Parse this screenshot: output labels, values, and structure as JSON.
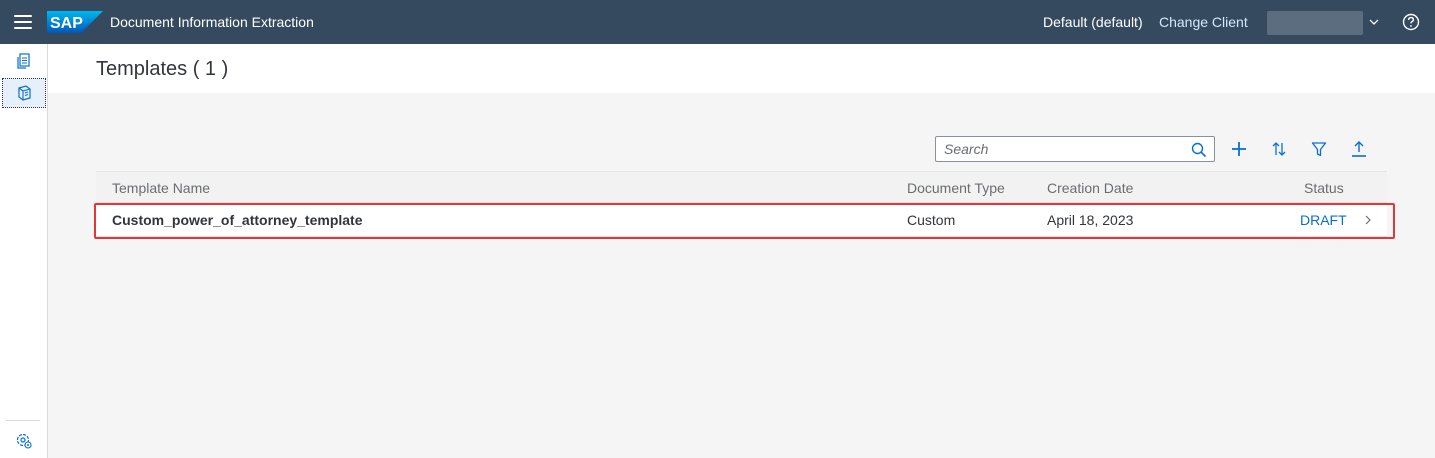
{
  "shell": {
    "title": "Document Information Extraction",
    "logo_text": "SAP",
    "tenant": "Default (default)",
    "change_client": "Change Client"
  },
  "icons": {
    "menu": "hamburger-menu-icon",
    "documents": "documents-icon",
    "templates": "templates-icon",
    "settings": "settings-icon",
    "help": "help-icon"
  },
  "page": {
    "title": "Templates ( 1 )"
  },
  "toolbar": {
    "search_placeholder": "Search"
  },
  "table": {
    "headers": {
      "name": "Template Name",
      "type": "Document Type",
      "date": "Creation Date",
      "status": "Status"
    },
    "rows": [
      {
        "name": "Custom_power_of_attorney_template",
        "type": "Custom",
        "date": "April 18, 2023",
        "status": "DRAFT"
      }
    ]
  },
  "colors": {
    "shell": "#354a5f",
    "accent": "#0a6ed1",
    "highlight": "#e0373a"
  }
}
